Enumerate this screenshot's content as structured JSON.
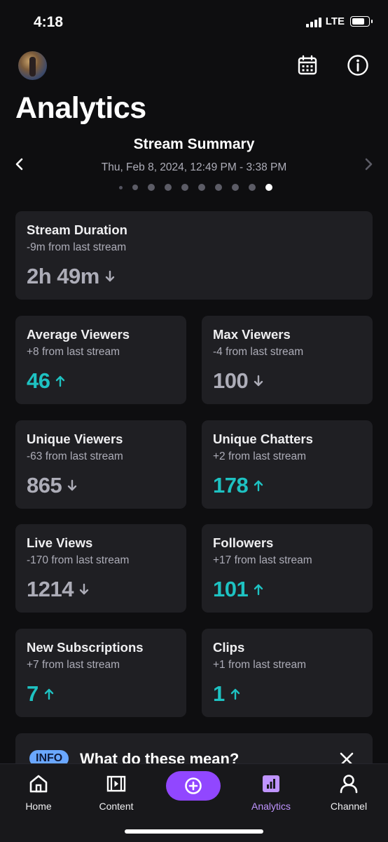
{
  "status_bar": {
    "time": "4:18",
    "network": "LTE"
  },
  "header": {
    "title": "Analytics"
  },
  "summary": {
    "title": "Stream Summary",
    "date_range": "Thu, Feb 8, 2024, 12:49 PM - 3:38 PM",
    "page_count": 10,
    "active_page": 10
  },
  "stats": {
    "stream_duration": {
      "label": "Stream Duration",
      "change": "-9m from last stream",
      "value": "2h 49m",
      "trend": "down"
    },
    "average_viewers": {
      "label": "Average Viewers",
      "change": "+8 from last stream",
      "value": "46",
      "trend": "up"
    },
    "max_viewers": {
      "label": "Max Viewers",
      "change": "-4 from last stream",
      "value": "100",
      "trend": "down"
    },
    "unique_viewers": {
      "label": "Unique Viewers",
      "change": "-63 from last stream",
      "value": "865",
      "trend": "down"
    },
    "unique_chatters": {
      "label": "Unique Chatters",
      "change": "+2 from last stream",
      "value": "178",
      "trend": "up"
    },
    "live_views": {
      "label": "Live Views",
      "change": "-170 from last stream",
      "value": "1214",
      "trend": "down"
    },
    "followers": {
      "label": "Followers",
      "change": "+17 from last stream",
      "value": "101",
      "trend": "up"
    },
    "new_subscriptions": {
      "label": "New Subscriptions",
      "change": "+7 from last stream",
      "value": "7",
      "trend": "up"
    },
    "clips": {
      "label": "Clips",
      "change": "+1 from last stream",
      "value": "1",
      "trend": "up"
    }
  },
  "info": {
    "badge": "INFO",
    "title": "What do these mean?"
  },
  "tabs": [
    {
      "label": "Home",
      "icon": "home-icon"
    },
    {
      "label": "Content",
      "icon": "film-icon"
    },
    {
      "label": "",
      "icon": "plus-circle-icon"
    },
    {
      "label": "Analytics",
      "icon": "bar-chart-icon"
    },
    {
      "label": "Channel",
      "icon": "person-icon"
    }
  ],
  "colors": {
    "accent": "#9147ff",
    "accent_light": "#bf94ff",
    "trend_up": "#1ec2c2",
    "trend_down": "#adadb8",
    "card_bg": "#1f1f23",
    "background": "#0e0e10"
  }
}
